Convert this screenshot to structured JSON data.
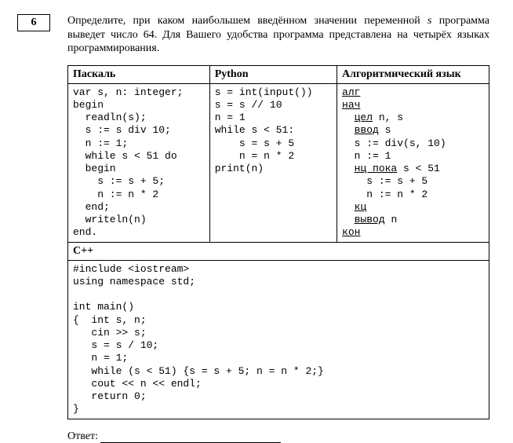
{
  "problem_number": "6",
  "prompt_parts": {
    "p1": "Определите, при каком наибольшем введённом значении переменной ",
    "var": "s",
    "p2": " программа выведет число 64. Для Вашего удобства программа представлена на четырёх языках программирования."
  },
  "headers": {
    "pascal": "Паскаль",
    "python": "Python",
    "alg": "Алгоритмический язык",
    "cpp": "C++"
  },
  "code": {
    "pascal": "var s, n: integer;\nbegin\n  readln(s);\n  s := s div 10;\n  n := 1;\n  while s < 51 do\n  begin\n    s := s + 5;\n    n := n * 2\n  end;\n  writeln(n)\nend.",
    "python": "s = int(input())\ns = s // 10\nn = 1\nwhile s < 51:\n    s = s + 5\n    n = n * 2\nprint(n)",
    "alg_lines": [
      {
        "u": "алг",
        "t": ""
      },
      {
        "u": "нач",
        "t": ""
      },
      {
        "u": "  цел",
        "t": " n, s"
      },
      {
        "u": "  ввод",
        "t": " s"
      },
      {
        "u": "",
        "t": "  s := div(s, 10)"
      },
      {
        "u": "",
        "t": "  n := 1"
      },
      {
        "u": "  нц пока",
        "t": " s < 51"
      },
      {
        "u": "",
        "t": "    s := s + 5"
      },
      {
        "u": "",
        "t": "    n := n * 2"
      },
      {
        "u": "  кц",
        "t": ""
      },
      {
        "u": "  вывод",
        "t": " n"
      },
      {
        "u": "кон",
        "t": ""
      }
    ],
    "cpp": "#include <iostream>\nusing namespace std;\n\nint main()\n{  int s, n;\n   cin >> s;\n   s = s / 10;\n   n = 1;\n   while (s < 51) {s = s + 5; n = n * 2;}\n   cout << n << endl;\n   return 0;\n}"
  },
  "answer_label": "Ответ: "
}
